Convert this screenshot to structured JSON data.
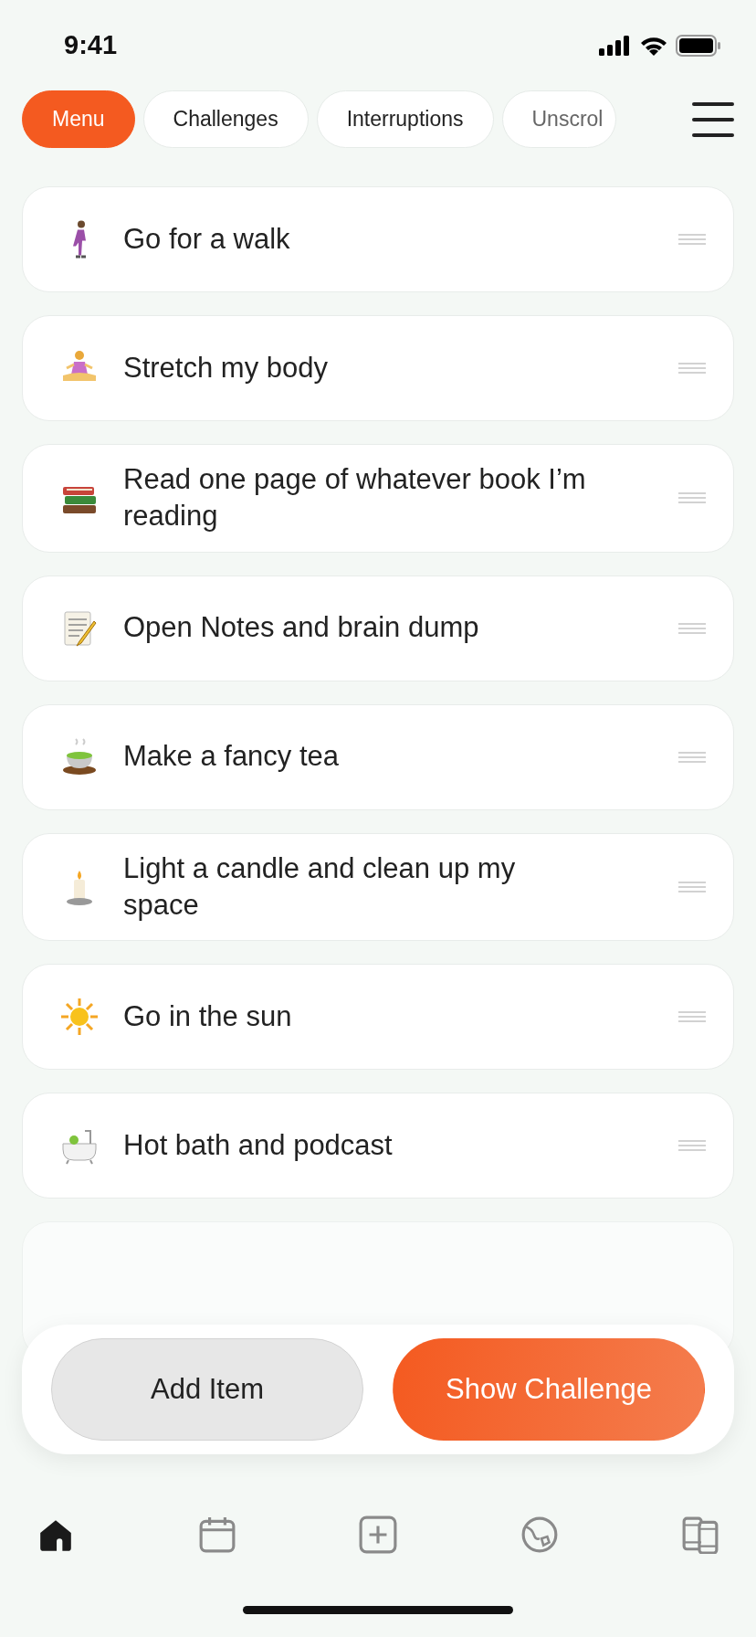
{
  "status_bar": {
    "time": "9:41"
  },
  "chips": [
    {
      "label": "Menu",
      "selected": true
    },
    {
      "label": "Challenges",
      "selected": false
    },
    {
      "label": "Interruptions",
      "selected": false
    },
    {
      "label": "Unscrol",
      "selected": false
    }
  ],
  "items": [
    {
      "label": "Go for a walk"
    },
    {
      "label": "Stretch my body"
    },
    {
      "label": "Read one page of whatever book I’m reading"
    },
    {
      "label": "Open Notes and brain dump"
    },
    {
      "label": "Make a fancy tea"
    },
    {
      "label": "Light a candle and clean up my space"
    },
    {
      "label": "Go in the sun"
    },
    {
      "label": "Hot bath and podcast"
    }
  ],
  "actions": [
    {
      "label": "Add Item",
      "kind": "secondary"
    },
    {
      "label": "Show Challenge",
      "kind": "primary"
    }
  ],
  "tab_bar": [
    {
      "selected": true
    },
    {
      "selected": false
    },
    {
      "selected": false
    },
    {
      "selected": false
    },
    {
      "selected": false
    }
  ]
}
